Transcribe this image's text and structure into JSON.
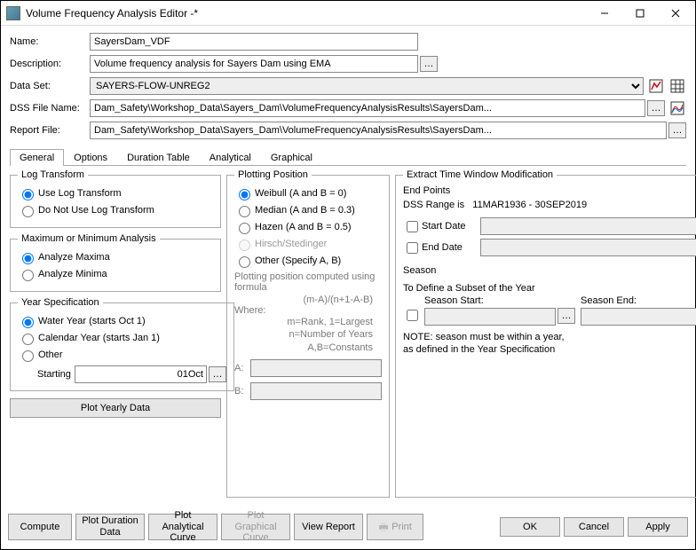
{
  "window": {
    "title": "Volume Frequency Analysis Editor -*"
  },
  "fields": {
    "name_label": "Name:",
    "name_value": "SayersDam_VDF",
    "desc_label": "Description:",
    "desc_value": "Volume frequency analysis for Sayers Dam using EMA",
    "dataset_label": "Data Set:",
    "dataset_value": "SAYERS-FLOW-UNREG2",
    "dssfile_label": "DSS File Name:",
    "dssfile_value": "Dam_Safety\\Workshop_Data\\Sayers_Dam\\VolumeFrequencyAnalysisResults\\SayersDam...",
    "report_label": "Report File:",
    "report_value": "Dam_Safety\\Workshop_Data\\Sayers_Dam\\VolumeFrequencyAnalysisResults\\SayersDam..."
  },
  "tabs": {
    "t0": "General",
    "t1": "Options",
    "t2": "Duration Table",
    "t3": "Analytical",
    "t4": "Graphical"
  },
  "logtransform": {
    "legend": "Log Transform",
    "r0": "Use Log Transform",
    "r1": "Do Not Use Log Transform"
  },
  "maxmin": {
    "legend": "Maximum or Minimum Analysis",
    "r0": "Analyze Maxima",
    "r1": "Analyze Minima"
  },
  "yearspec": {
    "legend": "Year Specification",
    "r0": "Water Year (starts Oct 1)",
    "r1": "Calendar Year (starts Jan 1)",
    "r2": "Other",
    "starting_label": "Starting",
    "starting_value": "01Oct",
    "plot_btn": "Plot Yearly Data"
  },
  "plotting": {
    "legend": "Plotting Position",
    "r0": "Weibull (A and B = 0)",
    "r1": "Median (A and B = 0.3)",
    "r2": "Hazen (A and B = 0.5)",
    "r3": "Hirsch/Stedinger",
    "r4": "Other (Specify A, B)",
    "desc": "Plotting position computed using formula",
    "formula": "(m-A)/(n+1-A-B)",
    "where": "Where:",
    "def1": "m=Rank, 1=Largest",
    "def2": "n=Number of Years",
    "def3": "A,B=Constants",
    "a_label": "A:",
    "b_label": "B:"
  },
  "timewin": {
    "legend": "Extract Time Window Modification",
    "endpoints": "End Points",
    "dssrange_label": "DSS Range is",
    "dssrange_value": "11MAR1936 - 30SEP2019",
    "start_label": "Start Date",
    "end_label": "End Date",
    "season_legend": "Season",
    "subset": "To Define a Subset of the Year",
    "season_start": "Season Start:",
    "season_end": "Season End:",
    "note1": "NOTE: season must be within a year,",
    "note2": "as defined in the Year Specification"
  },
  "footer": {
    "compute": "Compute",
    "plot_duration": "Plot Duration\nData",
    "plot_analytical": "Plot Analytical\nCurve",
    "plot_graphical": "Plot Graphical\nCurve",
    "view_report": "View Report",
    "print": "Print",
    "ok": "OK",
    "cancel": "Cancel",
    "apply": "Apply"
  }
}
